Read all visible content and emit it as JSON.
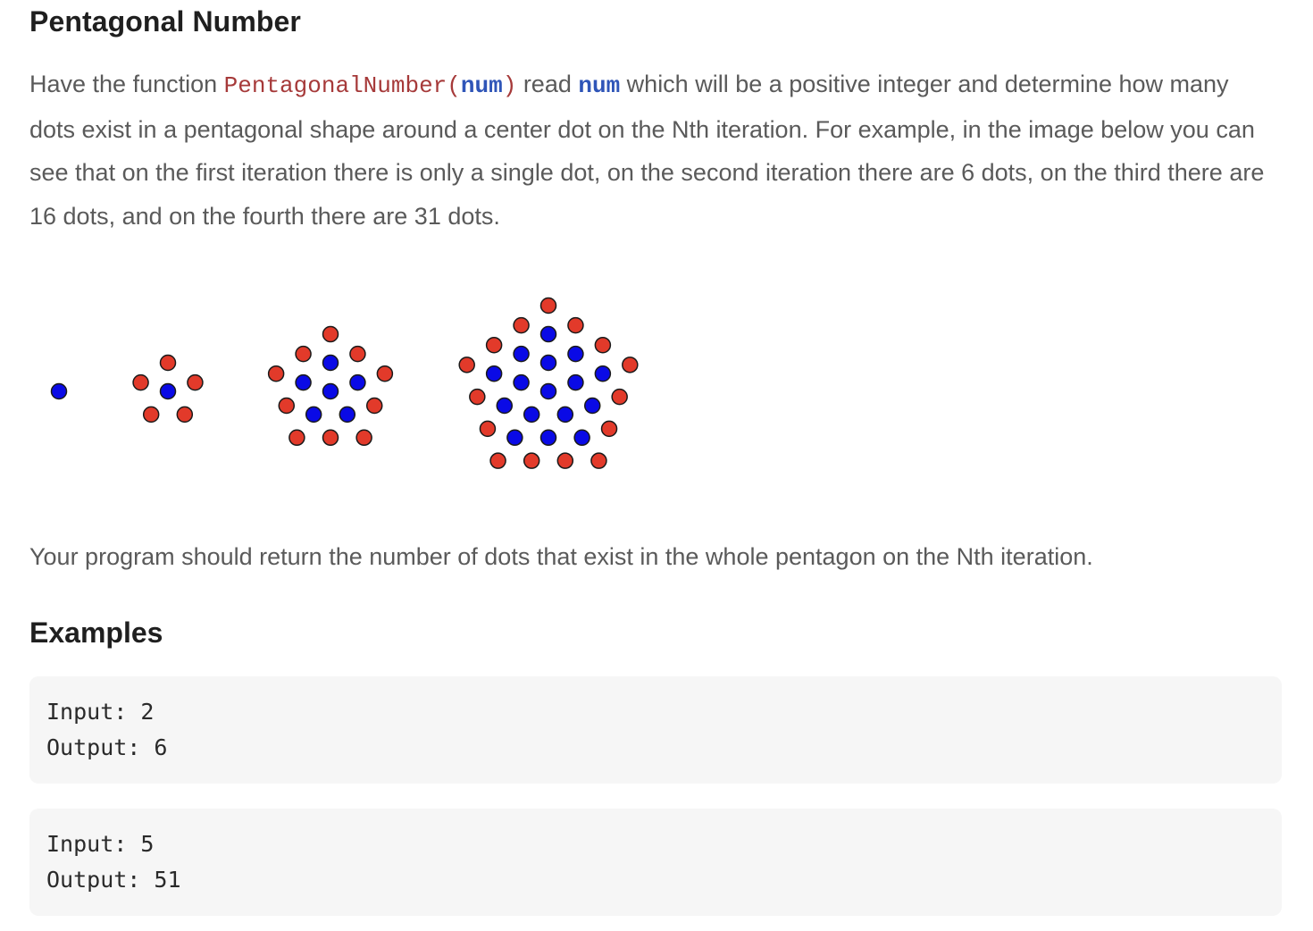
{
  "title": "Pentagonal Number",
  "intro": {
    "part1": "Have the function ",
    "function_name": "PentagonalNumber",
    "paren_open": "(",
    "param": "num",
    "paren_close": ")",
    "part2": " read ",
    "param_ref": "num",
    "part3": " which will be a positive integer and determine how many dots exist in a pentagonal shape around a center dot on the Nth iteration. For example, in the image below you can see that on the first iteration there is only a single dot, on the second iteration there are 6 dots, on the third there are 16 dots, and on the fourth there are 31 dots."
  },
  "diagram": {
    "colors": {
      "inner": "#0a0ae6",
      "outer": "#e23a2a",
      "stroke": "#1a1a1a"
    },
    "iterations": [
      {
        "iteration": 1,
        "total_dots": 1
      },
      {
        "iteration": 2,
        "total_dots": 6
      },
      {
        "iteration": 3,
        "total_dots": 16
      },
      {
        "iteration": 4,
        "total_dots": 31
      }
    ]
  },
  "summary": "Your program should return the number of dots that exist in the whole pentagon on the Nth iteration.",
  "examples_heading": "Examples",
  "examples": [
    {
      "input": "Input: 2",
      "output": "Output: 6"
    },
    {
      "input": "Input: 5",
      "output": "Output: 51"
    }
  ]
}
